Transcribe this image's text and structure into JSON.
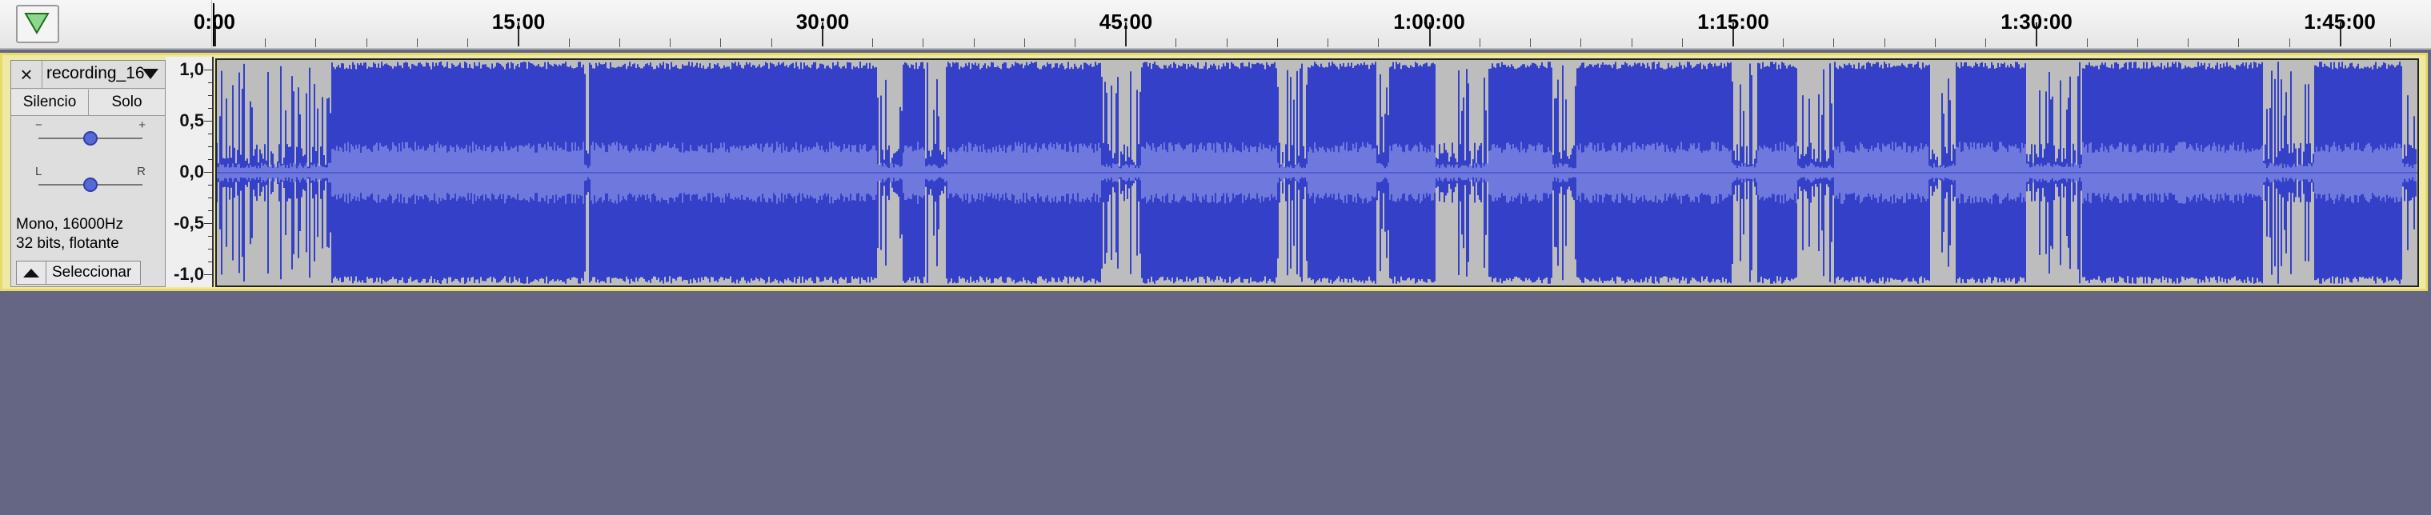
{
  "ruler": {
    "labels": [
      "0:00",
      "15:00",
      "30:00",
      "45:00",
      "1:00:00",
      "1:15:00",
      "1:30:00",
      "1:45:00"
    ]
  },
  "track": {
    "name": "recording_16",
    "close_glyph": "×",
    "mute_label": "Silencio",
    "solo_label": "Solo",
    "gain_min": "−",
    "gain_max": "+",
    "pan_left": "L",
    "pan_right": "R",
    "gain_level": 0.5,
    "pan_level": 0.5,
    "format_line1": "Mono, 16000Hz",
    "format_line2": "32 bits, flotante",
    "select_label": "Seleccionar",
    "y_labels": [
      "1,0",
      "0,5",
      "0,0",
      "-0,5",
      "-1,0"
    ]
  },
  "colors": {
    "waveform": "#3340c7",
    "waveform_rms": "#6f78dd",
    "clip_background": "#bdbdbd",
    "track_selected_border": "#e9db6a",
    "background": "#646683"
  },
  "icons": {
    "play_head": "triangle-down-icon",
    "track_menu": "chevron-down-icon",
    "collapse": "triangle-up-icon"
  }
}
